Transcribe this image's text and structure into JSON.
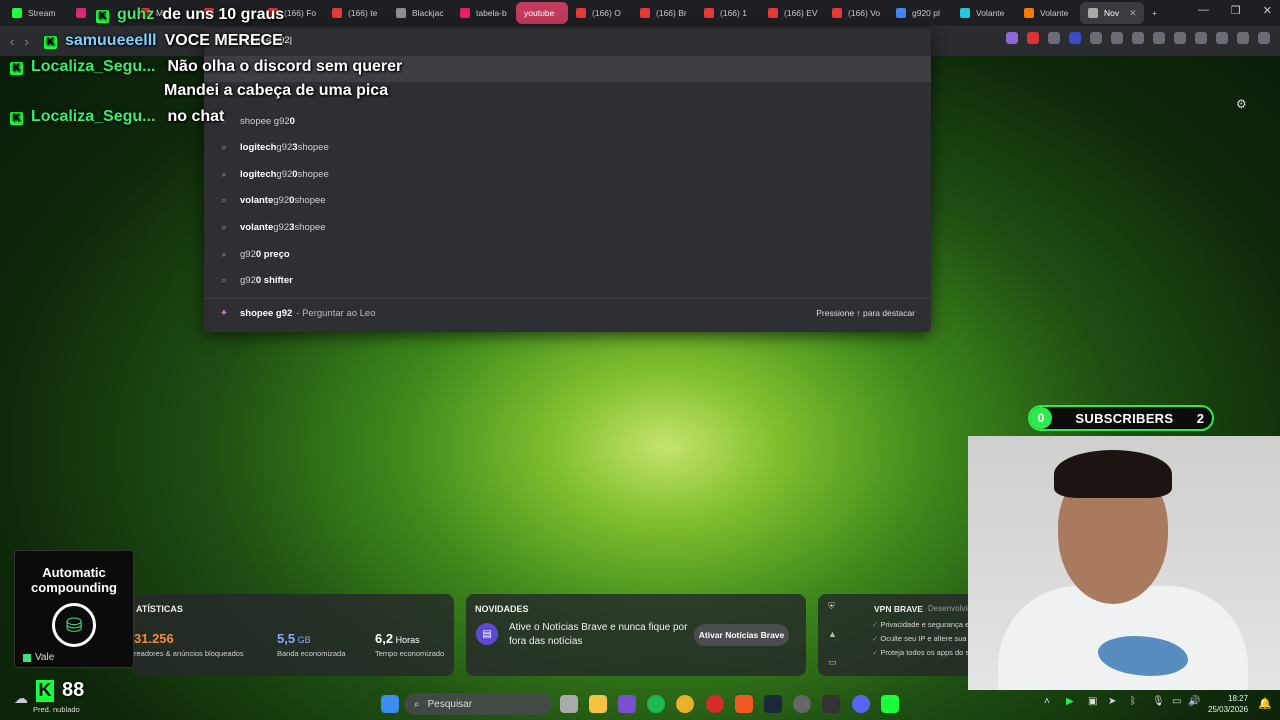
{
  "tabs": [
    {
      "label": "Stream",
      "color": "#1aff3a"
    },
    {
      "label": "",
      "color": "#d62976"
    },
    {
      "label": "Mi",
      "color": "#e53935"
    },
    {
      "label": "",
      "color": "#e53935"
    },
    {
      "label": "(166) Fo",
      "color": "#e53935"
    },
    {
      "label": "(166) te",
      "color": "#e53935"
    },
    {
      "label": "Blackjac",
      "color": "#8e8e8e"
    },
    {
      "label": "tabela-b",
      "color": "#e91e63"
    },
    {
      "label": "youtube",
      "color": "#c23b5d"
    },
    {
      "label": "(166) O",
      "color": "#e53935"
    },
    {
      "label": "(166) Br",
      "color": "#e53935"
    },
    {
      "label": "(166) 1",
      "color": "#e53935"
    },
    {
      "label": "(166) EV",
      "color": "#e53935"
    },
    {
      "label": "(166) Vo",
      "color": "#e53935"
    },
    {
      "label": "g920 pl",
      "color": "#4285f4"
    },
    {
      "label": "Volante",
      "color": "#26c6da"
    },
    {
      "label": "Volante",
      "color": "#f57c00"
    },
    {
      "label": "Nov",
      "color": "#aaaaaa"
    }
  ],
  "window": {
    "minimize": "—",
    "maximize": "❐",
    "close": "✕"
  },
  "omnibox": {
    "query": "shopee g92|",
    "suggestions": [
      {
        "prefix": "shopee g92",
        "bold": "0",
        "suffix": ""
      },
      {
        "prefix": "",
        "bold": "logitech",
        "mid": " g92",
        "bold2": "3",
        "suffix": " shopee"
      },
      {
        "prefix": "",
        "bold": "logitech",
        "mid": " g92",
        "bold2": "0",
        "suffix": " shopee"
      },
      {
        "prefix": "",
        "bold": "volante",
        "mid": " g92",
        "bold2": "0",
        "suffix": " shopee"
      },
      {
        "prefix": "",
        "bold": "volante",
        "mid": " g92",
        "bold2": "3",
        "suffix": " shopee"
      },
      {
        "prefix": "g92",
        "bold": "0 preço",
        "suffix": ""
      },
      {
        "prefix": "g92",
        "bold": "0 shifter",
        "suffix": ""
      }
    ],
    "leo_query": "shopee g92",
    "leo_suffix": " - Perguntar ao Leo",
    "leo_hint": "Pressione ↑ para destacar"
  },
  "chat": [
    {
      "user": "guhz",
      "message": "de uns 10 graus"
    },
    {
      "user": "samuueeelll",
      "message": "VOCE MERECE"
    },
    {
      "user": "Localiza_Segu...",
      "message": "Não olha o discord sem querer"
    },
    {
      "extra": "Mandei a cabeça de uma pica"
    },
    {
      "user": "Localiza_Segu...",
      "message": "no chat"
    }
  ],
  "subscribers": {
    "current": "0",
    "label": "SUBSCRIBERS",
    "goal": "2",
    "accent": "#2eea4c"
  },
  "compounding": {
    "title": "Automatic compounding",
    "badge": "Vale"
  },
  "stats": {
    "title": "ATÍSTICAS",
    "items": [
      {
        "value": "31.256",
        "unit": "",
        "label": "readores & anúncios bloqueados",
        "color": "#f08a3c"
      },
      {
        "value": "5,5",
        "unit": " GB",
        "label": "Banda economizada",
        "color": "#8aa9ff"
      },
      {
        "value": "6,2",
        "unit": " Horas",
        "label": "Tempo economizado",
        "color": "#ffffff"
      }
    ]
  },
  "news": {
    "title": "NOVIDADES",
    "text": "Ative o Notícias Brave e nunca fique por fora das notícias",
    "button": "Ativar Notícias Brave"
  },
  "vpn": {
    "title": "VPN BRAVE",
    "subtitle": "Desenvolvido por",
    "items": [
      "Privacidade e segurança extra on-lin",
      "Oculte seu IP e altere sua localizac",
      "Proteja todos os apps do seu dis"
    ]
  },
  "viewers": {
    "count": "88"
  },
  "weather": {
    "text": "Pred. nublado"
  },
  "taskbar": {
    "search_placeholder": "Pesquisar"
  },
  "clock": {
    "time": "18:27",
    "date": "25/03/2026"
  }
}
